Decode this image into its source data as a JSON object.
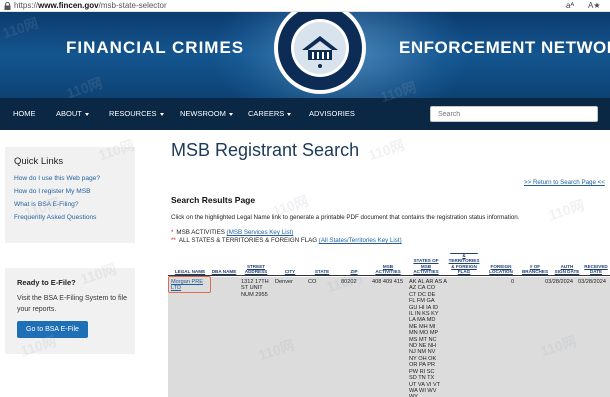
{
  "browser": {
    "url_scheme": "https://",
    "url_host": "www.fincen.gov",
    "url_path": "/msb-state-selector",
    "read_aloud_label": "aᴬ",
    "text_size_label": "A★"
  },
  "banner": {
    "left_title": "FINANCIAL CRIMES",
    "right_title": "ENFORCEMENT NETWORK"
  },
  "nav": {
    "items": [
      {
        "label": "HOME"
      },
      {
        "label": "ABOUT"
      },
      {
        "label": "RESOURCES"
      },
      {
        "label": "NEWSROOM"
      },
      {
        "label": "CAREERS"
      },
      {
        "label": "ADVISORIES"
      }
    ],
    "search_placeholder": "Search"
  },
  "quick_links": {
    "heading": "Quick Links",
    "links": [
      "How do I use this Web page?",
      "How do I register My MSB",
      "What is BSA E-Filing?",
      "Frequently Asked Questions"
    ]
  },
  "efile": {
    "heading": "Ready to E-File?",
    "text": "Visit the BSA E-Filing System to file your reports.",
    "button": "Go to BSA E-File"
  },
  "main": {
    "title": "MSB Registrant Search",
    "return_link": ">> Return to Search Page <<",
    "results_heading": "Search Results Page",
    "instructions": "Click on the highlighted Legal Name link to generate a printable PDF document that contains the registration status information.",
    "key1_prefix": "*",
    "key1_text": "MSB ACTIVITIES",
    "key1_link": "(MSB Services Key List)",
    "key2_prefix": "**",
    "key2_text": "ALL STATES & TERRITORIES & FOREIGN FLAG",
    "key2_link": "(All States/Territories Key List)"
  },
  "table": {
    "headers": [
      "LEGAL NAME",
      "DBA NAME",
      "STREET\nADDRESS",
      "CITY",
      "STATE",
      "ZIP",
      "MSB\nACTIVITIES",
      "STATES OF\nMSB\nACTIVITIES",
      "ALL STATES\n&\nTERRITORIES\n& FOREIGN\nFLAG",
      "FOREIGN\nLOCATION",
      "# OF\nBRANCHES",
      "AUTH\nSIGN DATE",
      "RECEIVED\nDATE"
    ],
    "row": {
      "legal_name": "Morgan PRE\nLTD",
      "dba_name": "",
      "street": "1312 17TH\nST UNIT\nNUM 2955",
      "city": "Denver",
      "state": "CO",
      "zip": "80202",
      "activities": "408 409 415",
      "states": "AK AL AR AS A\nAZ CA CO\nCT DC DE\nFL FM GA\nGU HI IA ID\nIL IN KS KY\nLA MA MD\nME MH MI\nMN MO MP\nMS MT NC\nND NE NH\nNJ NM NV\nNY OH OK\nOR PA PR\nPW RI SC\nSD TN TX\nUT VA VI VT\nWA WI WV\nWY",
      "all_states_flag": "",
      "foreign_location": "",
      "branches": "0",
      "auth_sign_date": "03/28/2024",
      "received_date": "03/28/2024"
    }
  },
  "watermark": "110网",
  "colors": {
    "banner": "#14558f",
    "nav": "#0a2744",
    "link": "#1f5f9e",
    "button": "#1f6fb6",
    "highlight": "#e06a4a"
  }
}
